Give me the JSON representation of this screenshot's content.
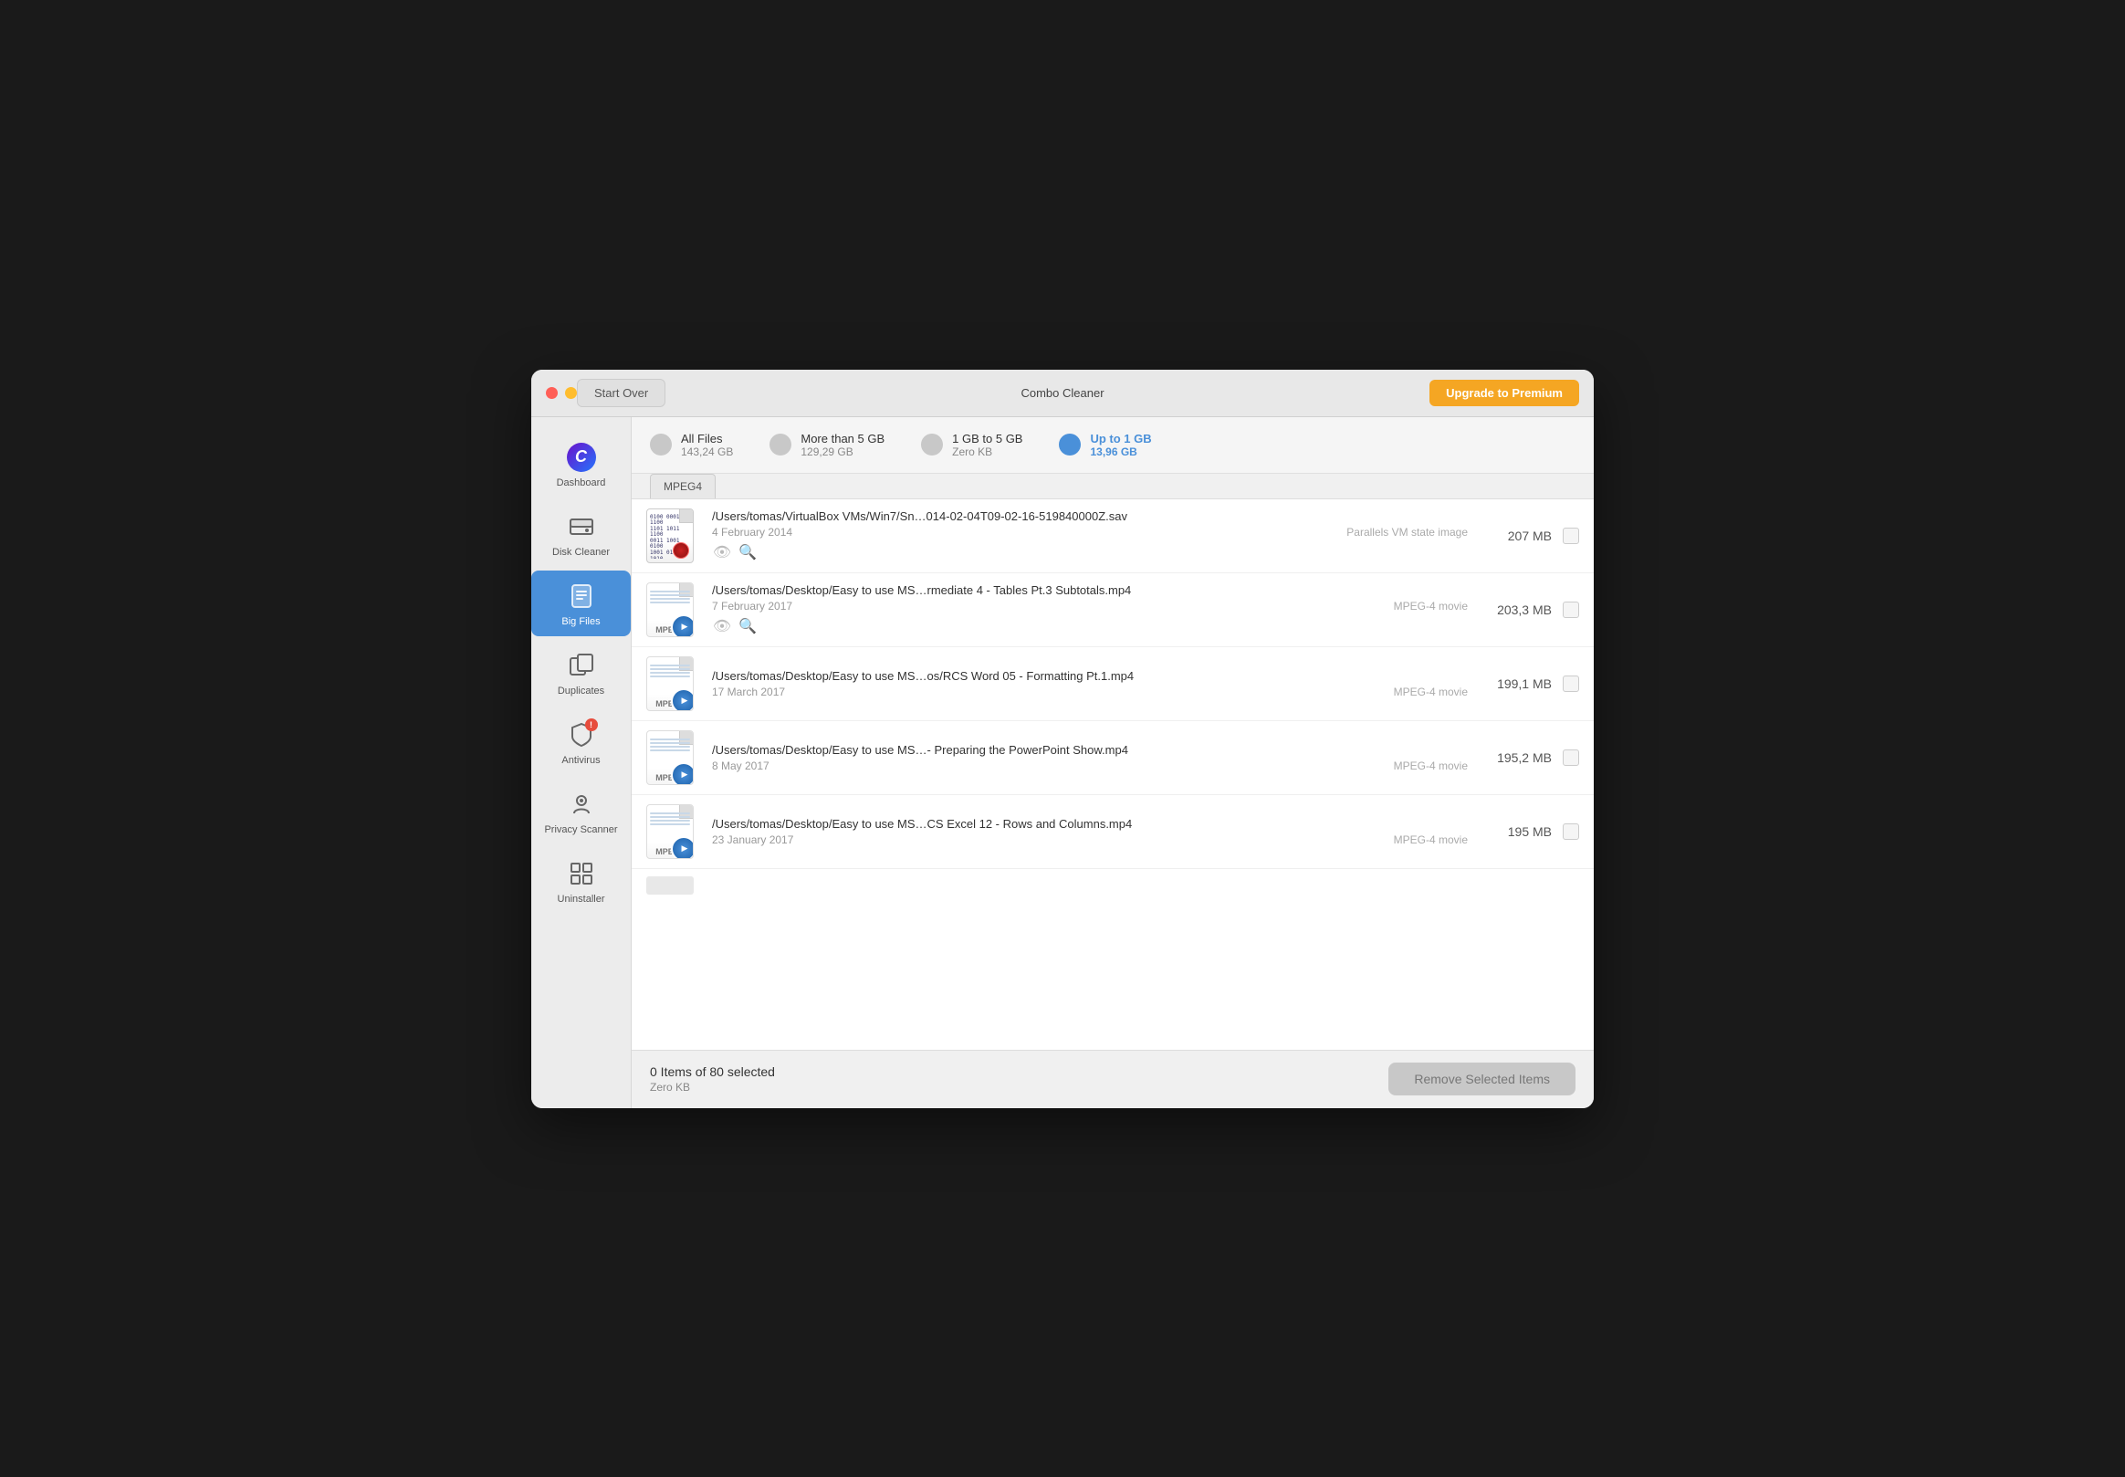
{
  "window": {
    "title": "Combo Cleaner"
  },
  "titlebar": {
    "start_over_label": "Start Over",
    "upgrade_label": "Upgrade to Premium"
  },
  "sidebar": {
    "items": [
      {
        "id": "dashboard",
        "label": "Dashboard",
        "icon": "C",
        "active": false
      },
      {
        "id": "disk-cleaner",
        "label": "Disk Cleaner",
        "icon": "disk",
        "active": false
      },
      {
        "id": "big-files",
        "label": "Big Files",
        "icon": "box",
        "active": true
      },
      {
        "id": "duplicates",
        "label": "Duplicates",
        "icon": "duplicate",
        "active": false
      },
      {
        "id": "antivirus",
        "label": "Antivirus",
        "icon": "shield",
        "active": false
      },
      {
        "id": "privacy-scanner",
        "label": "Privacy Scanner",
        "icon": "hand",
        "active": false
      },
      {
        "id": "uninstaller",
        "label": "Uninstaller",
        "icon": "grid",
        "active": false
      }
    ]
  },
  "filters": [
    {
      "label": "All Files",
      "size": "143,24 GB",
      "active": false
    },
    {
      "label": "More than 5 GB",
      "size": "129,29 GB",
      "active": false
    },
    {
      "label": "1 GB to 5 GB",
      "size": "Zero KB",
      "active": false
    },
    {
      "label": "Up to 1 GB",
      "size": "13,96 GB",
      "active": true
    }
  ],
  "tab": "MPEG4",
  "files": [
    {
      "path": "/Users/tomas/VirtualBox VMs/Win7/Sn…014-02-04T09-02-16-519840000Z.sav",
      "date": "4 February 2014",
      "type": "Parallels VM state image",
      "size": "207 MB",
      "icon_type": "sav"
    },
    {
      "path": "/Users/tomas/Desktop/Easy to use MS…rmediate 4 - Tables Pt.3 Subtotals.mp4",
      "date": "7 February 2017",
      "type": "MPEG-4 movie",
      "size": "203,3 MB",
      "icon_type": "mp4"
    },
    {
      "path": "/Users/tomas/Desktop/Easy to use MS…os/RCS Word 05 - Formatting Pt.1.mp4",
      "date": "17 March 2017",
      "type": "MPEG-4 movie",
      "size": "199,1 MB",
      "icon_type": "mp4"
    },
    {
      "path": "/Users/tomas/Desktop/Easy to use MS…- Preparing the PowerPoint Show.mp4",
      "date": "8 May 2017",
      "type": "MPEG-4 movie",
      "size": "195,2 MB",
      "icon_type": "mp4"
    },
    {
      "path": "/Users/tomas/Desktop/Easy to use MS…CS Excel 12 - Rows and Columns.mp4",
      "date": "23 January 2017",
      "type": "MPEG-4 movie",
      "size": "195 MB",
      "icon_type": "mp4"
    }
  ],
  "status": {
    "selected_count": "0 Items of 80 selected",
    "selected_size": "Zero KB",
    "remove_label": "Remove Selected Items"
  }
}
